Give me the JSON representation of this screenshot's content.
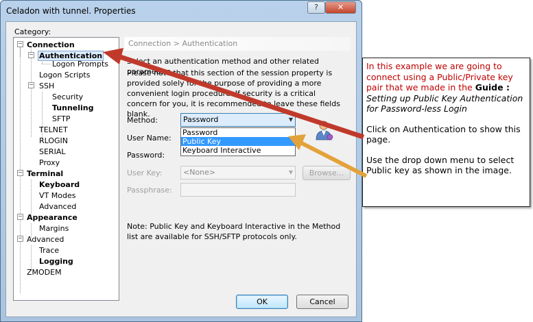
{
  "window": {
    "title": "Celadon with tunnel. Properties",
    "help_btn": "?",
    "close_btn": "✕"
  },
  "category_label": "Category:",
  "tree": [
    {
      "label": "Connection",
      "bold": true,
      "expander": "−"
    },
    {
      "label": "Authentication",
      "bold": true,
      "selected": true,
      "expander": "−"
    },
    {
      "label": "Logon Prompts"
    },
    {
      "label": "Logon Scripts"
    },
    {
      "label": "SSH",
      "expander": "−"
    },
    {
      "label": "Security"
    },
    {
      "label": "Tunneling",
      "bold": true
    },
    {
      "label": "SFTP"
    },
    {
      "label": "TELNET"
    },
    {
      "label": "RLOGIN"
    },
    {
      "label": "SERIAL"
    },
    {
      "label": "Proxy"
    },
    {
      "label": "Terminal",
      "bold": true,
      "expander": "−"
    },
    {
      "label": "Keyboard",
      "bold": true
    },
    {
      "label": "VT Modes"
    },
    {
      "label": "Advanced"
    },
    {
      "label": "Appearance",
      "bold": true,
      "expander": "−"
    },
    {
      "label": "Margins"
    },
    {
      "label": "Advanced",
      "expander": "−"
    },
    {
      "label": "Trace"
    },
    {
      "label": "Logging",
      "bold": true
    },
    {
      "label": "ZMODEM"
    }
  ],
  "panel": {
    "breadcrumb": "Connection > Authentication",
    "intro": "Select an authentication method and other related parameters.",
    "warning": "Please note that this section of the session property is provided solely for the purpose of providing a more convenient login procedure. If security is a critical concern for you, it is recommended to leave these fields blank.",
    "method_label": "Method:",
    "method_value": "Password",
    "method_options": [
      "Password",
      "Public Key",
      "Keyboard Interactive"
    ],
    "username_label": "User Name:",
    "password_label": "Password:",
    "userkey_label": "User Key:",
    "userkey_value": "<None>",
    "browse_label": "Browse...",
    "passphrase_label": "Passphrase:",
    "note": "Note: Public Key and Keyboard Interactive in the Method list are available for SSH/SFTP protocols only."
  },
  "buttons": {
    "ok": "OK",
    "cancel": "Cancel"
  },
  "annotation": {
    "para1_red": "In this example we are going to connect using a Public/Private key pair that we made in the ",
    "guide_label": "Guide :",
    "guide_title": "Setting up Public Key Authentication for Password-less Login",
    "para2": "Click on Authentication to show this page.",
    "para3": "Use the drop down menu to select Public key as shown in the image.",
    "red_color": "#c00000",
    "arrow_colors": [
      "#c0392b",
      "#e3a23a"
    ]
  }
}
